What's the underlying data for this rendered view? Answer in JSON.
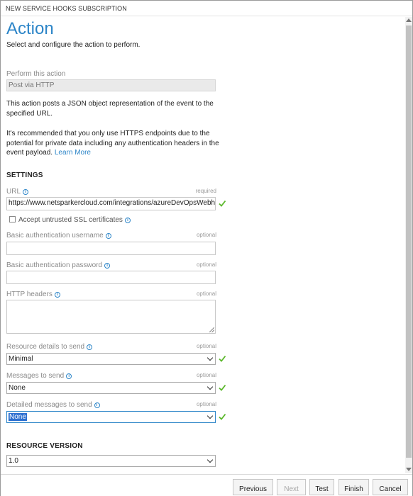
{
  "window": {
    "title": "NEW SERVICE HOOKS SUBSCRIPTION"
  },
  "header": {
    "title": "Action",
    "subtitle": "Select and configure the action to perform."
  },
  "perform_action": {
    "label": "Perform this action",
    "value": "Post via HTTP"
  },
  "description": {
    "line1": "This action posts a JSON object representation of the event to the specified URL.",
    "line2": "It's recommended that you only use HTTPS endpoints due to the potential for private data including any authentication headers in the event payload.",
    "link": "Learn More"
  },
  "settings": {
    "header": "SETTINGS",
    "url": {
      "label": "URL",
      "hint": "required",
      "value": "https://www.netsparkercloud.com/integrations/azureDevOpsWebhook"
    },
    "ssl": {
      "label": "Accept untrusted SSL certificates",
      "checked": false
    },
    "username": {
      "label": "Basic authentication username",
      "hint": "optional",
      "value": ""
    },
    "password": {
      "label": "Basic authentication password",
      "hint": "optional",
      "value": ""
    },
    "headers": {
      "label": "HTTP headers",
      "hint": "optional",
      "value": ""
    },
    "resource_details": {
      "label": "Resource details to send",
      "hint": "optional",
      "value": "Minimal"
    },
    "messages": {
      "label": "Messages to send",
      "hint": "optional",
      "value": "None"
    },
    "detailed_messages": {
      "label": "Detailed messages to send",
      "hint": "optional",
      "value": "None"
    }
  },
  "resource_version": {
    "header": "RESOURCE VERSION",
    "value": "1.0"
  },
  "footer": {
    "previous": "Previous",
    "next": "Next",
    "test": "Test",
    "finish": "Finish",
    "cancel": "Cancel"
  },
  "colors": {
    "accent": "#2c85c8",
    "valid": "#5cb82c",
    "selection": "#2c6fd0"
  },
  "icons": [
    "info-icon",
    "checkmark-icon",
    "chevron-down-icon"
  ]
}
